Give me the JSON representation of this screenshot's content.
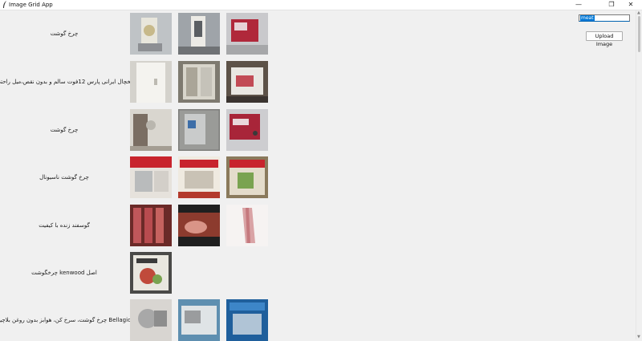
{
  "window": {
    "title": "Image Grid App",
    "minimize": "—",
    "restore": "❐",
    "close": "✕"
  },
  "search": {
    "value": "meat"
  },
  "upload_label": "Upload Image",
  "rows": [
    {
      "label": "چرخ گوشت"
    },
    {
      "label": "یخچال ایرانی پارس 12فوت سالم و بدون نقص،میل راحتی"
    },
    {
      "label": "چرخ گوشت"
    },
    {
      "label": "چرخ گوشت ناسیونال"
    },
    {
      "label": "گوسفند زنده با کیفیت"
    },
    {
      "label": "اصل kenwood چرخگوشت"
    },
    {
      "label": "Bellagio چرخ گوشت، سرخ کن، هوابز بدون روغن بلاچیو"
    }
  ]
}
